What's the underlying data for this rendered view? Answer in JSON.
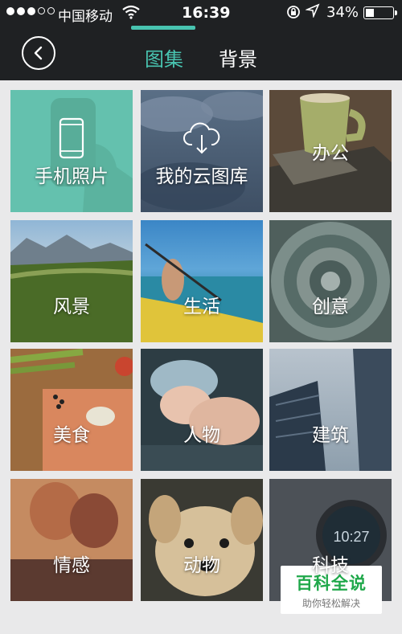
{
  "status_bar": {
    "carrier": "中国移动",
    "time": "16:39",
    "battery_percent": "34%",
    "battery_level": 0.34
  },
  "header": {
    "tabs": [
      {
        "label": "图集",
        "active": true
      },
      {
        "label": "背景",
        "active": false
      }
    ],
    "accent_color": "#48c4b0"
  },
  "categories": [
    {
      "label": "手机照片",
      "icon": "phone-icon"
    },
    {
      "label": "我的云图库",
      "icon": "cloud-download-icon"
    },
    {
      "label": "办公"
    },
    {
      "label": "风景"
    },
    {
      "label": "生活"
    },
    {
      "label": "创意"
    },
    {
      "label": "美食"
    },
    {
      "label": "人物"
    },
    {
      "label": "建筑"
    },
    {
      "label": "情感"
    },
    {
      "label": "动物"
    },
    {
      "label": "科技"
    }
  ],
  "watermark": {
    "title": "百科全说",
    "subtitle": "助你轻松解决"
  }
}
